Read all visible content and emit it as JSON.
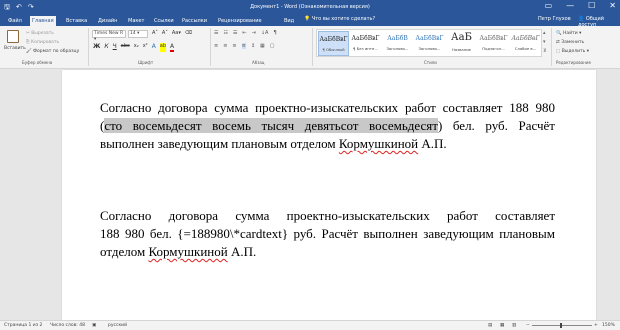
{
  "window": {
    "title": "Документ1 - Word (Ознакомительная версия)",
    "tell_me": "Что вы хотите сделать?",
    "user": "Петр Глухов",
    "share": "Общий доступ",
    "ctrl_restore": "▭",
    "ctrl_min": "—",
    "ctrl_max": "☐",
    "ctrl_close": "✕"
  },
  "quick_access": {
    "save": "🖫",
    "undo": "↶",
    "redo": "↷"
  },
  "tabs": [
    "Файл",
    "Главная",
    "Вставка",
    "Дизайн",
    "Макет",
    "Ссылки",
    "Рассылки",
    "Рецензирование",
    "Вид"
  ],
  "clipboard": {
    "paste": "Вставить",
    "cut": "Вырезать",
    "copy": "Копировать",
    "format_painter": "Формат по образцу",
    "group": "Буфер обмена"
  },
  "font": {
    "family": "Times New R",
    "size": "14",
    "group": "Шрифт",
    "row1": [
      "A˄",
      "A˅",
      "Aa▾",
      "⌫"
    ],
    "row2": [
      "Ж",
      "К",
      "Ч",
      "abc",
      "x₂",
      "x²",
      "A",
      "ab",
      "A"
    ]
  },
  "paragraph": {
    "group": "Абзац",
    "row1": [
      "☰",
      "☷",
      "☰",
      "⇤",
      "⇥",
      "↓A",
      "¶"
    ],
    "row2": [
      "≡",
      "≡",
      "≡",
      "≡",
      "↕",
      "▦",
      "▢"
    ]
  },
  "styles": {
    "group": "Стили",
    "items": [
      {
        "sample": "АаБбВвГ",
        "name": "¶ Обычный"
      },
      {
        "sample": "АаБбВвГ",
        "name": "¶ Без инте..."
      },
      {
        "sample": "АаБбВ",
        "name": "Заголово..."
      },
      {
        "sample": "АаБбВвГ",
        "name": "Заголово..."
      },
      {
        "sample": "АаБ",
        "name": "Название"
      },
      {
        "sample": "АаБбВвГ",
        "name": "Подзагол..."
      },
      {
        "sample": "АаБбВвГ",
        "name": "Слабое в..."
      }
    ]
  },
  "editing": {
    "find": "Найти",
    "replace": "Заменить",
    "select": "Выделить",
    "group": "Редактирование"
  },
  "document": {
    "p1_line1": "Согласно договора сумма проектно-изыскательских работ составляет 188 980",
    "p1_line2_open": "(",
    "p1_line2_highlight": "сто восемьдесят восемь тысяч девятьсот восемьдесят",
    "p1_line2_rest": ") бел. руб. Расчёт",
    "p1_line3_a": "выполнен заведующим плановым отделом ",
    "p1_line3_name": "Кормушкиной",
    "p1_line3_b": " А.П.",
    "p2_line1": "Согласно договора сумма проектно-изыскательских работ составляет",
    "p2_line2": "188 980 бел. {=188980\\*cardtext} руб. Расчёт выполнен заведующим плановым",
    "p2_line3_a": "отделом ",
    "p2_line3_name": "Кормушкиной",
    "p2_line3_b": " А.П."
  },
  "status": {
    "page": "Страница 1 из 2",
    "words": "Число слов: 48",
    "lang": "русский",
    "zoom": "150%"
  }
}
